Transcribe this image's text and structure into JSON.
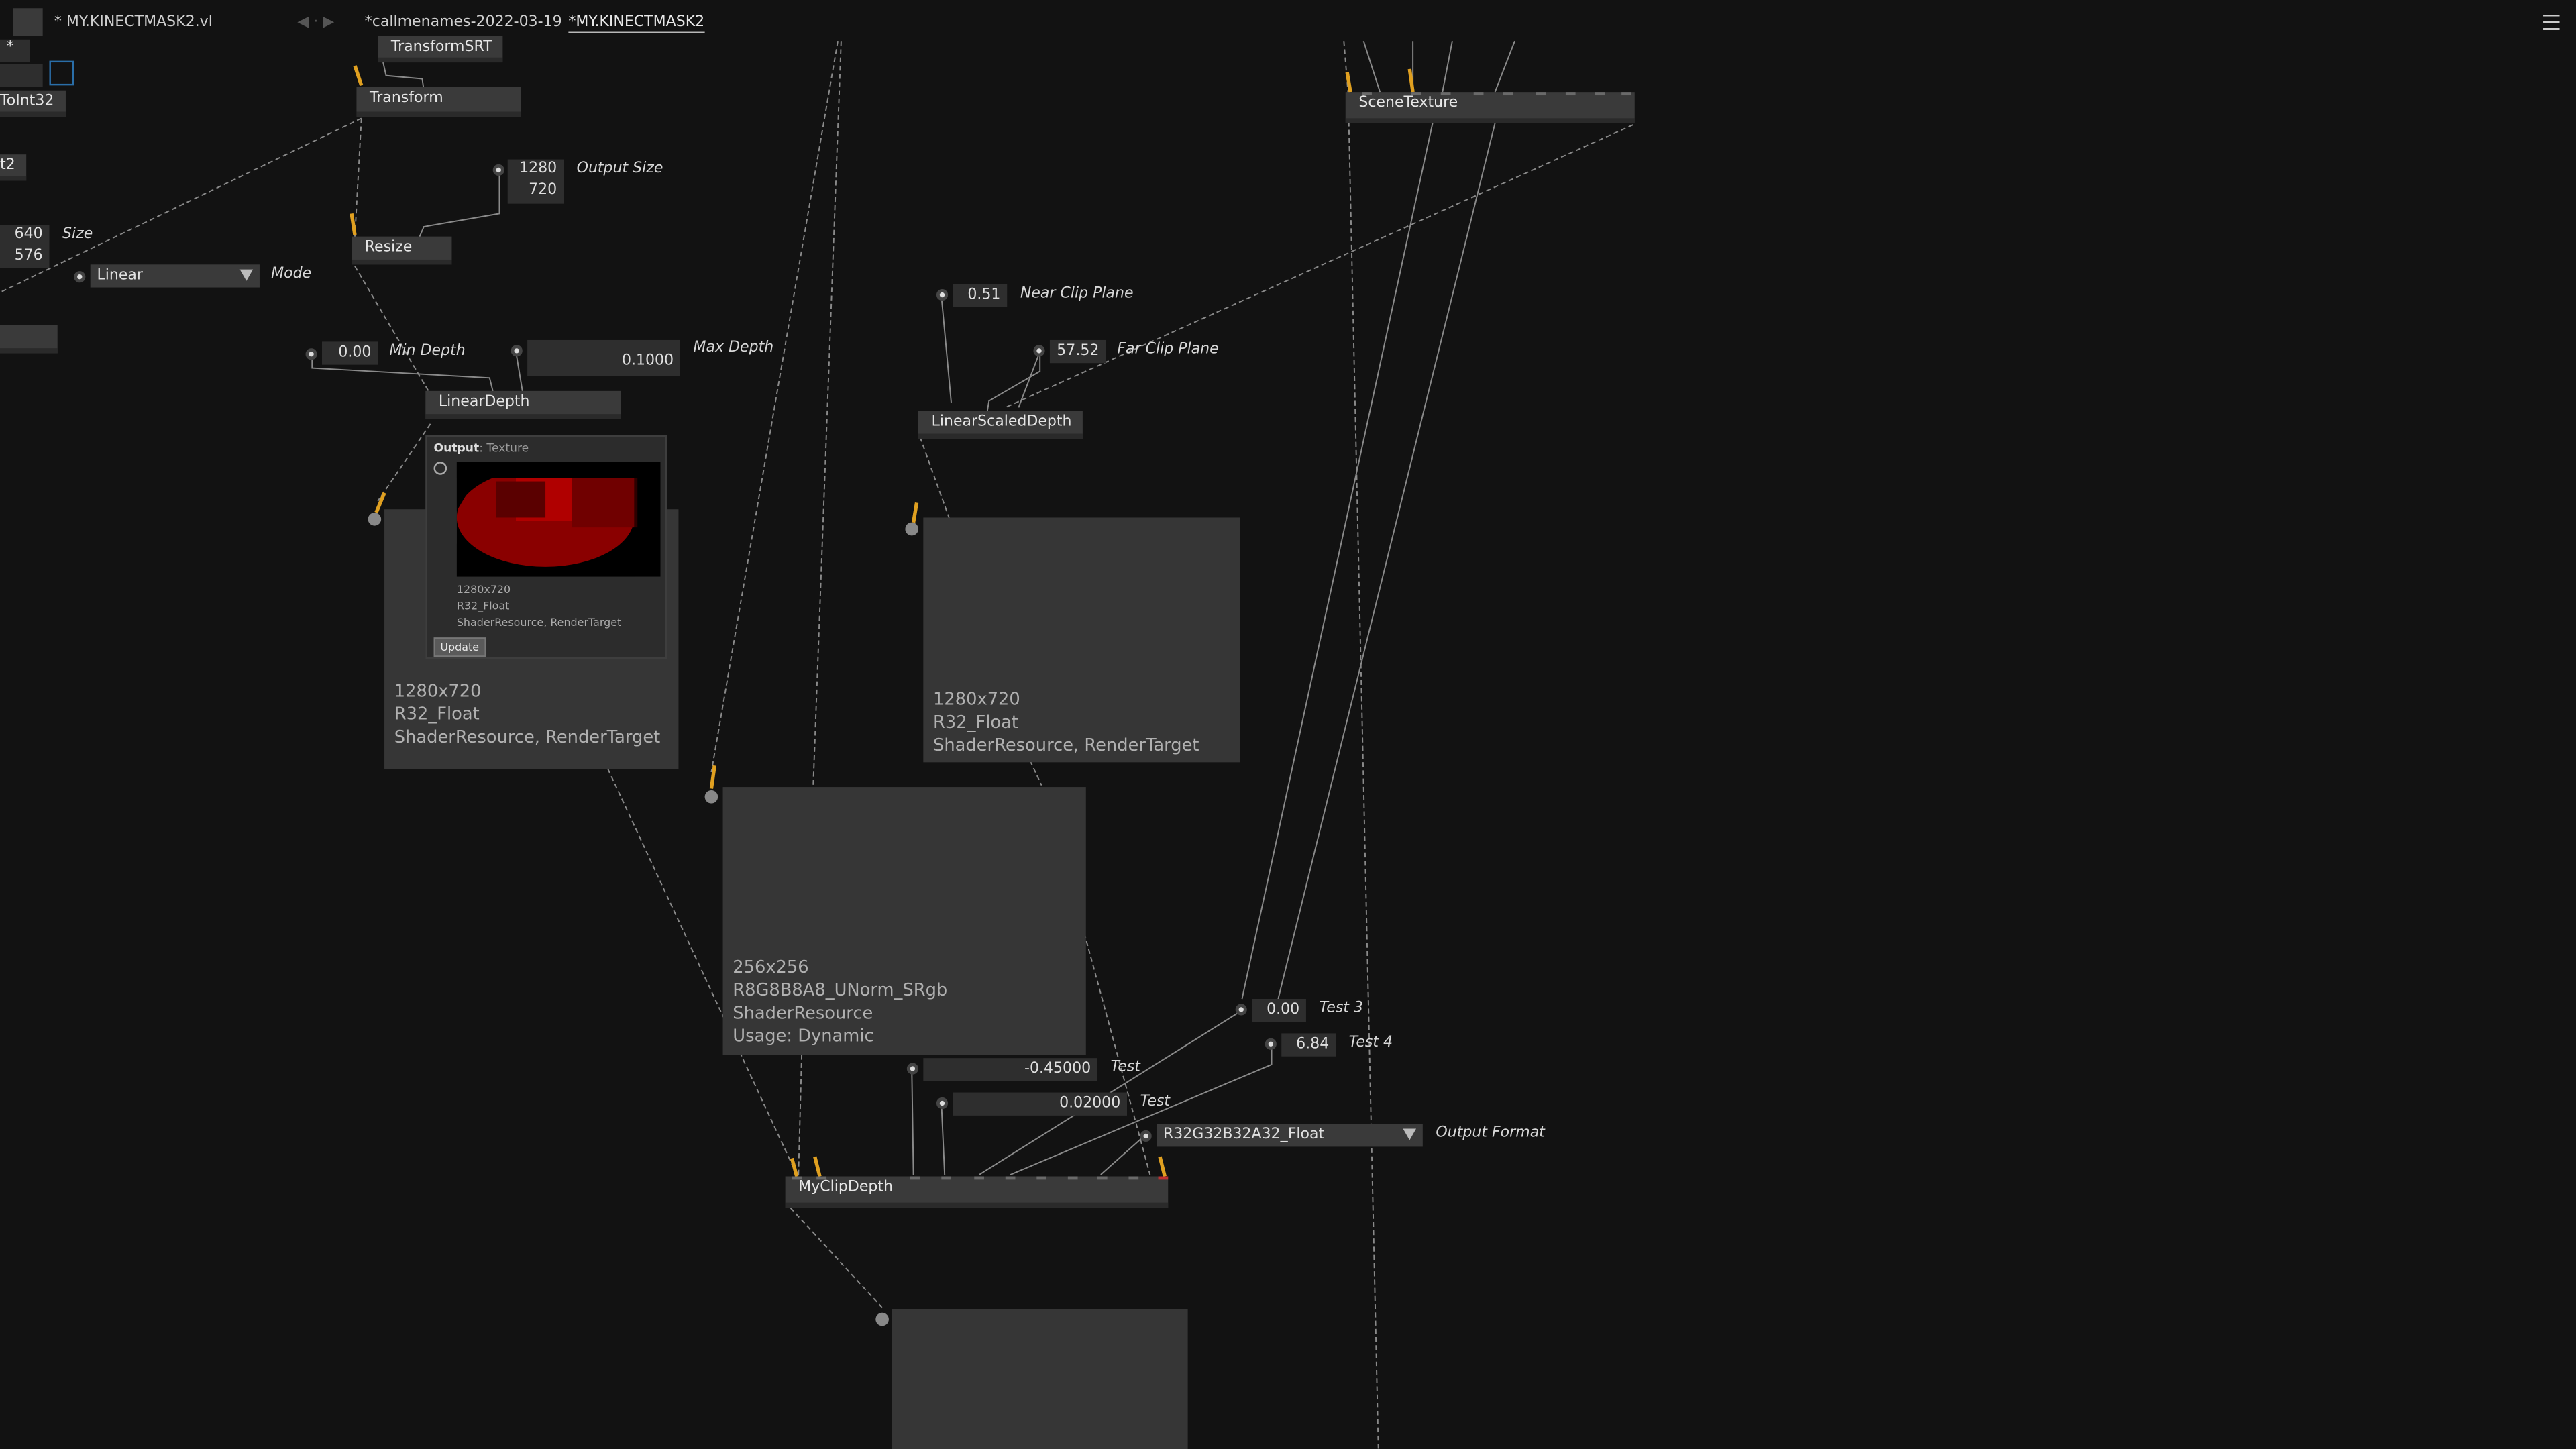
{
  "tabs": [
    {
      "label": "* MY.KINECTMASK2.vl",
      "active": false
    },
    {
      "label": "*callmenames-2022-03-19",
      "active": false
    },
    {
      "label": "*MY.KINECTMASK2",
      "active": true
    }
  ],
  "menu_icon": "hamburger-icon",
  "left_fragments": {
    "star": "*",
    "toint": "ToInt32",
    "t2": "t2",
    "size_w": "640",
    "size_h": "576",
    "size_label": "Size",
    "mode_value": "Linear",
    "mode_label": "Mode"
  },
  "nodes": {
    "transform_srt": "TransformSRT",
    "transform": "Transform",
    "resize": "Resize",
    "linear_depth": "LinearDepth",
    "linear_scaled_depth": "LinearScaledDepth",
    "scene_texture": "SceneTexture",
    "my_clip_depth": "MyClipDepth"
  },
  "inputs": {
    "output_size_w": "1280",
    "output_size_h": "720",
    "output_size_label": "Output Size",
    "min_depth": "0.00",
    "min_depth_label": "Min Depth",
    "max_depth": "0.1000",
    "max_depth_label": "Max Depth",
    "near_clip": "0.51",
    "near_clip_label": "Near Clip Plane",
    "far_clip": "57.52",
    "far_clip_label": "Far Clip Plane",
    "test3": "0.00",
    "test3_label": "Test 3",
    "test4": "6.84",
    "test4_label": "Test 4",
    "test_a": "-0.45000",
    "test_a_label": "Test",
    "test_b": "0.02000",
    "test_b_label": "Test",
    "output_format": "R32G32B32A32_Float",
    "output_format_label": "Output Format"
  },
  "tooltip": {
    "header": "Output",
    "type": ": Texture",
    "info": "1280x720\nR32_Float\nShaderResource, RenderTarget",
    "update_button": "Update"
  },
  "panels": {
    "linear_depth": "1280x720\nR32_Float\nShaderResource, RenderTarget",
    "linear_scaled": "1280x720\nR32_Float\nShaderResource, RenderTarget",
    "texture_256": "256x256\nR8G8B8A8_UNorm_SRgb\nShaderResource\nUsage: Dynamic"
  },
  "colors": {
    "background": "#121212",
    "node": "#3a3a3a",
    "panel": "#363636",
    "link_orange": "#e0a020",
    "preview_red": "#a00000"
  }
}
